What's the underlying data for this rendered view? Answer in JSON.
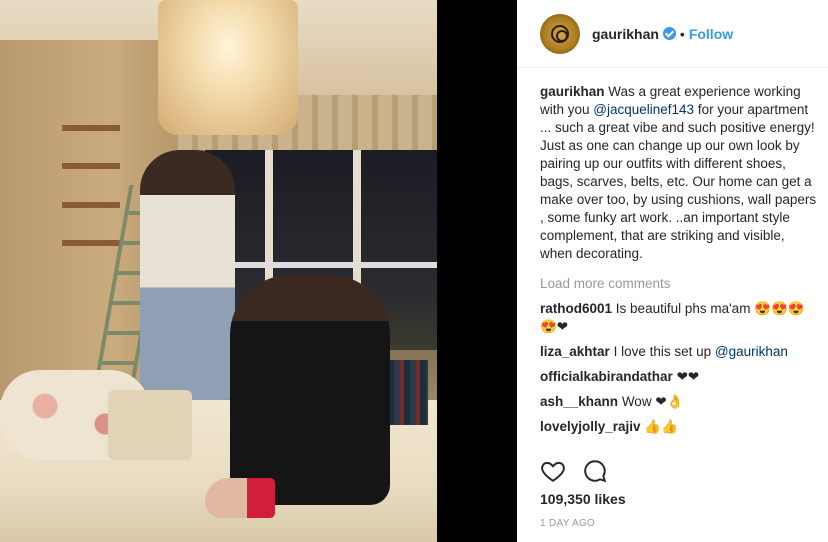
{
  "post": {
    "username": "gaurikhan",
    "follow_label": "Follow",
    "separator": "•"
  },
  "caption": {
    "user": "gaurikhan",
    "text_part1": "Was a great experience working with you ",
    "mention": "@jacquelinef143",
    "text_part2": " for your apartment ... such a great vibe and such positive energy!",
    "paragraph2": "Just as one can change up our own look by pairing up our outfits with different shoes, bags, scarves, belts, etc. Our home can get a make over too, by using cushions, wall papers , some funky art work. ..an important style complement, that are striking and visible, when decorating."
  },
  "load_more_label": "Load more comments",
  "comments": [
    {
      "user": "rathod6001",
      "text": "Is beautiful phs ma'am 😍😍😍😍❤"
    },
    {
      "user": "liza_akhtar",
      "text": "I love this set up ",
      "mention": "@gaurikhan"
    },
    {
      "user": "officialkabirandathar",
      "text": "❤❤"
    },
    {
      "user": "ash__khann",
      "text": "Wow ❤👌"
    },
    {
      "user": "lovelyjolly_rajiv",
      "text": "👍👍"
    }
  ],
  "likes_label": "109,350 likes",
  "time_label": "1 DAY AGO",
  "icons": {
    "heart": "heart-icon",
    "comment": "comment-icon",
    "verified": "verified-badge-icon"
  },
  "colors": {
    "link": "#3897f0",
    "mention": "#003569",
    "muted": "#999999"
  }
}
